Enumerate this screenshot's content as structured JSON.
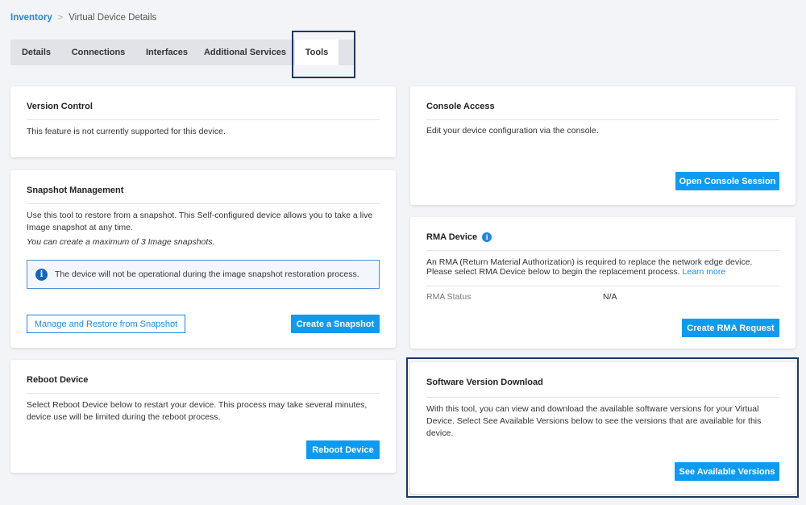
{
  "breadcrumb": {
    "root": "Inventory",
    "separator": ">",
    "current": "Virtual Device Details"
  },
  "tabs": [
    {
      "label": "Details"
    },
    {
      "label": "Connections"
    },
    {
      "label": "Interfaces"
    },
    {
      "label": "Additional Services"
    },
    {
      "label": "Tools"
    }
  ],
  "version_control": {
    "title": "Version Control",
    "text": "This feature is not currently supported for this device."
  },
  "snapshot": {
    "title": "Snapshot Management",
    "text1": "Use this tool to restore from a snapshot. This Self-configured device allows you to take a live",
    "text2": "Image snapshot at any time.",
    "note": "You can create a maximum of 3 Image snapshots.",
    "notice": "The device will not be operational during the image snapshot restoration process.",
    "manage_button": "Manage and Restore from Snapshot",
    "create_button": "Create a Snapshot"
  },
  "reboot": {
    "title": "Reboot Device",
    "text1": "Select Reboot Device below to restart your device. This process may take several minutes,",
    "text2": "device use will be limited during the reboot process.",
    "button": "Reboot Device"
  },
  "console": {
    "title": "Console Access",
    "text": "Edit your device configuration via the console.",
    "button": "Open Console Session"
  },
  "rma": {
    "title": "RMA Device",
    "text1": "An RMA (Return Material Authorization) is required to replace the network edge device.",
    "text2": "Please select RMA Device below to begin the replacement process.",
    "learn_more": "Learn more",
    "status_label": "RMA Status",
    "status_value": "N/A",
    "button": "Create RMA Request"
  },
  "software": {
    "title": "Software Version Download",
    "text1": "With this tool, you can view and download the available software versions for your Virtual",
    "text2": "Device. Select See Available Versions below to see the versions that are available for this",
    "text3": "device.",
    "button": "See Available Versions"
  },
  "colors": {
    "accent": "#0d9bf2",
    "highlight": "#1f3864",
    "background": "#f3f4f7"
  }
}
